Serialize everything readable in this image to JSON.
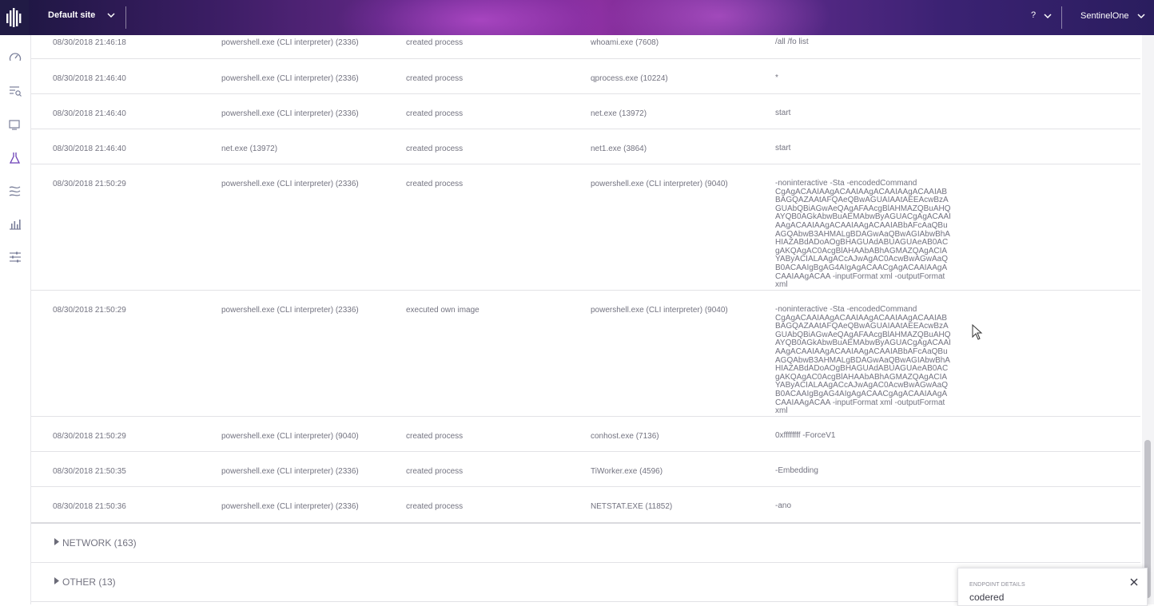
{
  "header": {
    "site_label": "Default site",
    "help_label": "?",
    "user_label": "SentinelOne"
  },
  "sidebar": {
    "items": [
      {
        "icon": "dashboard-gauge-icon"
      },
      {
        "icon": "search-list-icon"
      },
      {
        "icon": "devices-icon"
      },
      {
        "icon": "threat-flask-icon"
      },
      {
        "icon": "network-routes-icon"
      },
      {
        "icon": "reports-chart-icon"
      },
      {
        "icon": "settings-sliders-icon"
      }
    ]
  },
  "rows": [
    {
      "time": "08/30/2018 21:46:18",
      "source": "powershell.exe (CLI interpreter) (2336)",
      "action": "created process",
      "target": "whoami.exe (7608)",
      "args": "/all /fo list"
    },
    {
      "time": "08/30/2018 21:46:40",
      "source": "powershell.exe (CLI interpreter) (2336)",
      "action": "created process",
      "target": "qprocess.exe (10224)",
      "args": "*"
    },
    {
      "time": "08/30/2018 21:46:40",
      "source": "powershell.exe (CLI interpreter) (2336)",
      "action": "created process",
      "target": "net.exe (13972)",
      "args": "start"
    },
    {
      "time": "08/30/2018 21:46:40",
      "source": "net.exe (13972)",
      "action": "created process",
      "target": "net1.exe (3864)",
      "args": "start"
    },
    {
      "time": "08/30/2018 21:50:29",
      "source": "powershell.exe (CLI interpreter) (2336)",
      "action": "created process",
      "target": "powershell.exe (CLI interpreter) (9040)",
      "args": "-noninteractive -Sta -encodedCommand CgAgACAAIAAgACAAIAAgACAAIAAgACAAIABBAGQAZAAtAFQAeQBwAGUAIAAtAEEAcwBzAGUAbQBiAGwAeQAgAFAAcgBlAHMAZQBuAHQAYQB0AGkAbwBuAEMAbwByAGUACgAgACAAIAAgACAAIAAgACAAIAAgACAAIABbAFcAaQBuAGQAbwB3AHMALgBDAGwAaQBwAGIAbwBhAHIAZABdADoAOgBHAGUAdABUAGUAeAB0ACgAKQAgAC0AcgBlAHAAbABhAGMAZQAgACIAYAByACIALAAgACcAJwAgAC0AcwBwAGwAaQB0ACAAIgBgAG4AIgAgACAACgAgACAAIAAgACAAIAAgACAA -inputFormat xml -outputFormat xml"
    },
    {
      "time": "08/30/2018 21:50:29",
      "source": "powershell.exe (CLI interpreter) (2336)",
      "action": "executed own image",
      "target": "powershell.exe (CLI interpreter) (9040)",
      "args": "-noninteractive -Sta -encodedCommand CgAgACAAIAAgACAAIAAgACAAIAAgACAAIABBAGQAZAAtAFQAeQBwAGUAIAAtAEEAcwBzAGUAbQBiAGwAeQAgAFAAcgBlAHMAZQBuAHQAYQB0AGkAbwBuAEMAbwByAGUACgAgACAAIAAgACAAIAAgACAAIAAgACAAIABbAFcAaQBuAGQAbwB3AHMALgBDAGwAaQBwAGIAbwBhAHIAZABdADoAOgBHAGUAdABUAGUAeAB0ACgAKQAgAC0AcgBlAHAAbABhAGMAZQAgACIAYAByACIALAAgACcAJwAgAC0AcwBwAGwAaQB0ACAAIgBgAG4AIgAgACAACgAgACAAIAAgACAAIAAgACAA -inputFormat xml -outputFormat xml"
    },
    {
      "time": "08/30/2018 21:50:29",
      "source": "powershell.exe (CLI interpreter) (9040)",
      "action": "created process",
      "target": "conhost.exe (7136)",
      "args": "0xffffffff -ForceV1"
    },
    {
      "time": "08/30/2018 21:50:35",
      "source": "powershell.exe (CLI interpreter) (2336)",
      "action": "created process",
      "target": "TiWorker.exe (4596)",
      "args": "-Embedding"
    },
    {
      "time": "08/30/2018 21:50:36",
      "source": "powershell.exe (CLI interpreter) (2336)",
      "action": "created process",
      "target": "NETSTAT.EXE (11852)",
      "args": "-ano"
    }
  ],
  "sections": [
    {
      "label": "NETWORK (163)"
    },
    {
      "label": "OTHER (13)"
    }
  ],
  "endpoint": {
    "title": "ENDPOINT DETAILS",
    "value": "codered"
  },
  "colors": {
    "header_gradient_mid": "#8a2f9e",
    "text": "#737380",
    "divider": "#e2e2e6"
  }
}
